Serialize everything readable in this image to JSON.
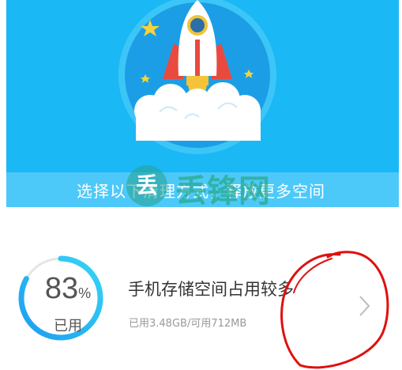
{
  "banner": {
    "text": "选择以下清理方式，释放更多空间"
  },
  "watermark": {
    "badge_char": "丢",
    "brand_text": "丢锋网"
  },
  "storage": {
    "percent": "83",
    "percent_sign": "%",
    "used_fraction": 0.83,
    "used_label": "已用",
    "title": "手机存储空间占用较多",
    "detail": "已用3.48GB/可用712MB"
  },
  "colors": {
    "header_bg": "#1ab8f5",
    "ring_start": "#1e9cf0",
    "ring_end": "#35d6f5",
    "ring_track": "#e6e6e6",
    "annotation": "#e01010"
  },
  "icons": {
    "rocket": "rocket-icon",
    "chevron": "chevron-right-icon"
  }
}
